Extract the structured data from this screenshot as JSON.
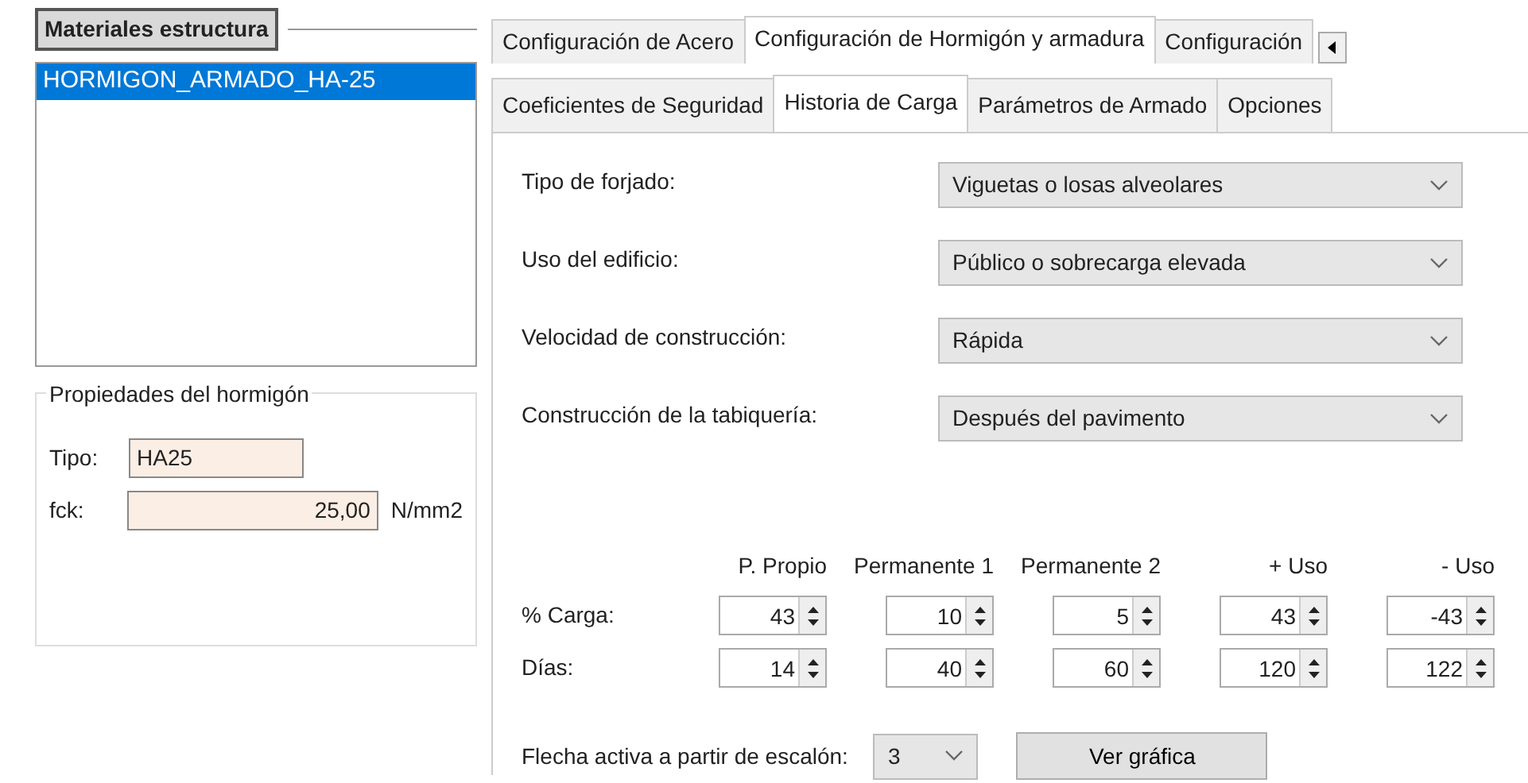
{
  "materials_panel": {
    "title": "Materiales estructura",
    "items": [
      {
        "label": "HORMIGON_ARMADO_HA-25",
        "selected": true
      }
    ]
  },
  "properties": {
    "title": "Propiedades del hormigón",
    "fields": [
      {
        "label": "Tipo:",
        "value": "HA25"
      },
      {
        "label": "fck:",
        "value": "25,00",
        "unit": "N/mm2"
      }
    ]
  },
  "tabs": [
    {
      "label": "Configuración de Acero",
      "selected": false
    },
    {
      "label": "Configuración de Hormigón y armadura",
      "selected": true
    },
    {
      "label": "Configuración",
      "selected": false
    }
  ],
  "subtabs": [
    {
      "label": "Coeficientes de Seguridad",
      "selected": false
    },
    {
      "label": "Historia de Carga",
      "selected": true
    },
    {
      "label": "Parámetros de Armado",
      "selected": false
    },
    {
      "label": "Opciones",
      "selected": false
    }
  ],
  "settings": [
    {
      "label": "Tipo de forjado:",
      "value": "Viguetas o losas alveolares"
    },
    {
      "label": "Uso del edificio:",
      "value": "Público o sobrecarga elevada"
    },
    {
      "label": "Velocidad de construcción:",
      "value": "Rápida"
    },
    {
      "label": "Construcción de la tabiquería:",
      "value": "Después del pavimento"
    }
  ],
  "load_table": {
    "columns": [
      "P. Propio",
      "Permanente 1",
      "Permanente 2",
      "+ Uso",
      "- Uso"
    ],
    "rows": [
      {
        "label": "% Carga:",
        "values": [
          "43",
          "10",
          "5",
          "43",
          "-43"
        ]
      },
      {
        "label": "Días:",
        "values": [
          "14",
          "40",
          "60",
          "120",
          "122"
        ]
      }
    ]
  },
  "step": {
    "label": "Flecha activa a partir de escalón:",
    "value": "3"
  },
  "buttons": [
    "Ver gráfica"
  ]
}
